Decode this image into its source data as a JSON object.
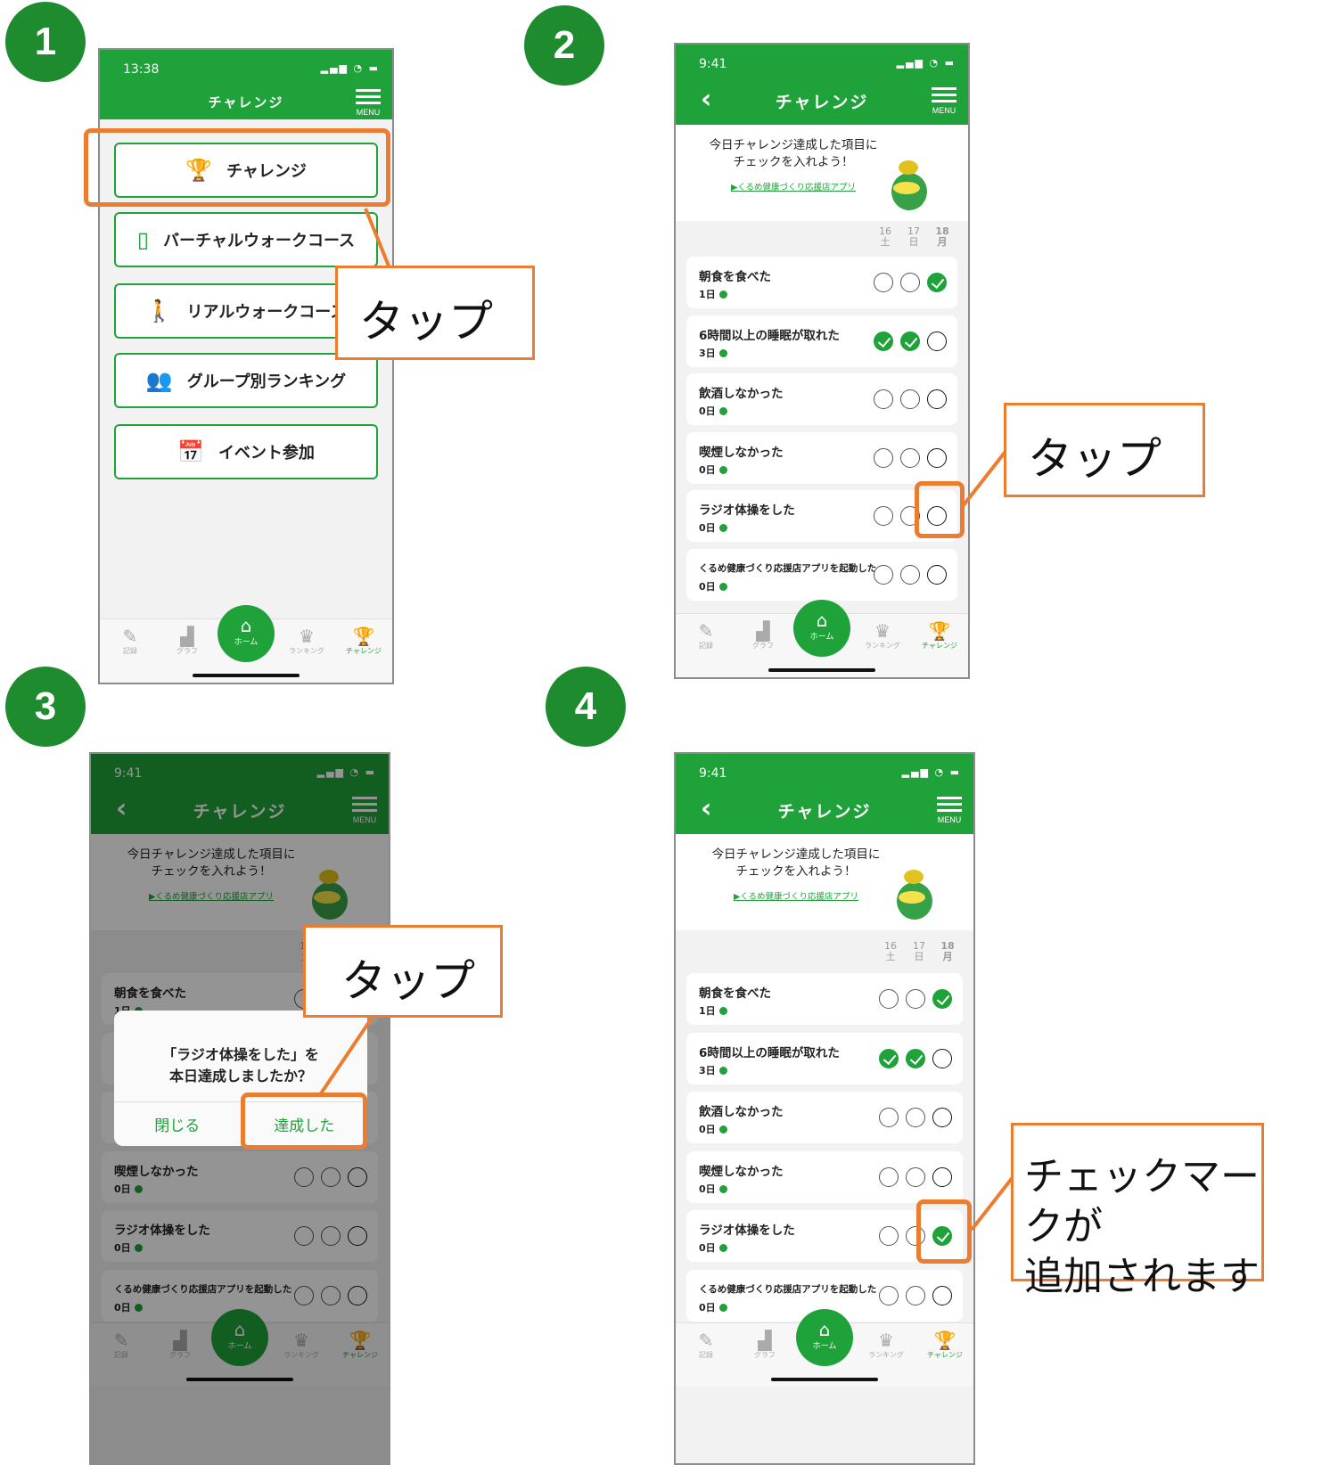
{
  "steps": [
    "1",
    "2",
    "3",
    "4"
  ],
  "colors": {
    "brand_green": "#1fa23a",
    "accent_orange": "#ec7d30",
    "step_badge": "#1f8b2f"
  },
  "status": {
    "time_1": "13:38",
    "time": "9:41"
  },
  "header": {
    "title": "チャレンジ",
    "menu_label": "MENU",
    "back_icon": "chevron-left-icon"
  },
  "home_menu": [
    {
      "label": "チャレンジ",
      "icon": "trophy-icon"
    },
    {
      "label": "バーチャルウォークコース",
      "icon": "phone-map-icon"
    },
    {
      "label": "リアルウォークコース",
      "icon": "walker-icon"
    },
    {
      "label": "グループ別ランキング",
      "icon": "group-icon"
    },
    {
      "label": "イベント参加",
      "icon": "calendar-star-icon"
    }
  ],
  "intro": {
    "line1": "今日チャレンジ達成した項目に",
    "line2": "チェックを入れよう！",
    "link": "▶くるめ健康づくり応援店アプリ"
  },
  "dates": [
    {
      "day": "16",
      "weekday": "土"
    },
    {
      "day": "17",
      "weekday": "日"
    },
    {
      "day": "18",
      "weekday": "月"
    }
  ],
  "challenges": [
    {
      "name": "朝食を食べた",
      "days": "1日"
    },
    {
      "name": "6時間以上の睡眠が取れた",
      "days": "3日"
    },
    {
      "name": "飲酒しなかった",
      "days": "0日"
    },
    {
      "name": "喫煙しなかった",
      "days": "0日"
    },
    {
      "name": "ラジオ体操をした",
      "days": "0日"
    },
    {
      "name": "くるめ健康づくり応援店アプリを起動した",
      "days": "0日"
    }
  ],
  "checks_before": [
    [
      false,
      false,
      true
    ],
    [
      true,
      true,
      false
    ],
    [
      false,
      false,
      false
    ],
    [
      false,
      false,
      false
    ],
    [
      false,
      false,
      false
    ],
    [
      false,
      false,
      false
    ]
  ],
  "checks_after": [
    [
      false,
      false,
      true
    ],
    [
      true,
      true,
      false
    ],
    [
      false,
      false,
      false
    ],
    [
      false,
      false,
      false
    ],
    [
      false,
      false,
      true
    ],
    [
      false,
      false,
      false
    ]
  ],
  "tabs": {
    "record": "記録",
    "graph": "グラフ",
    "home": "ホーム",
    "ranking": "ランキング",
    "challenge": "チャレンジ"
  },
  "dialog": {
    "message_line1": "「ラジオ体操をした」を",
    "message_line2": "本日達成しましたか？",
    "close": "閉じる",
    "confirm": "達成した",
    "covered_row": "6時間以上の睡眠が取れた"
  },
  "callouts": {
    "tap": "タップ",
    "result_line1": "チェックマークが",
    "result_line2": "追加されます"
  }
}
